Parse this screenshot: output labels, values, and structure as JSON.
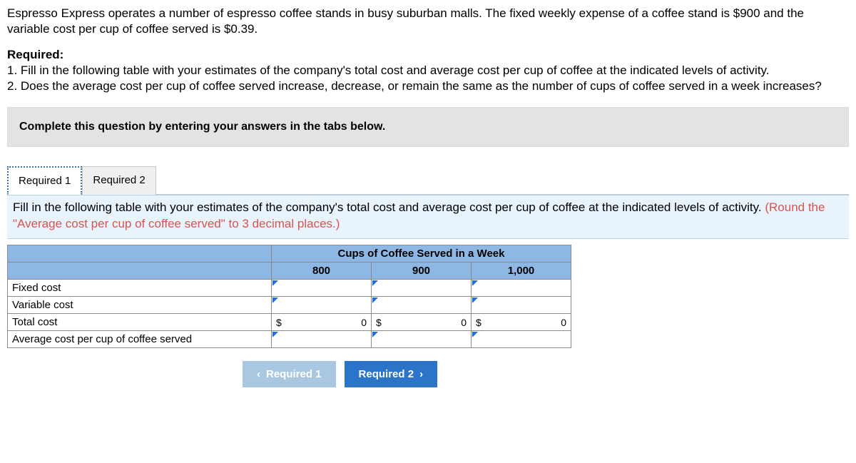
{
  "problem": {
    "p1": "Espresso Express operates a number of espresso coffee stands in busy suburban malls. The fixed weekly expense of a coffee stand is $900 and the variable cost per cup of coffee served is $0.39.",
    "required_label": "Required:",
    "q1": "1. Fill in the following table with your estimates of the company's total cost and average cost per cup of coffee at the indicated levels of activity.",
    "q2": "2. Does the average cost per cup of coffee served increase, decrease, or remain the same as the number of cups of coffee served in a week increases?"
  },
  "banner": "Complete this question by entering your answers in the tabs below.",
  "tabs": {
    "t1": "Required 1",
    "t2": "Required 2"
  },
  "instruction": {
    "main": "Fill in the following table with your estimates of the company's total cost and average cost per cup of coffee at the indicated levels of activity. ",
    "orange": "(Round the \"Average cost per cup of coffee served\" to 3 decimal places.)"
  },
  "table": {
    "header_span": "Cups of Coffee Served in a Week",
    "cols": [
      "800",
      "900",
      "1,000"
    ],
    "rows": {
      "fixed": "Fixed cost",
      "variable": "Variable cost",
      "total": "Total cost",
      "avg": "Average cost per cup of coffee served"
    },
    "currency": "$",
    "totals": [
      "0",
      "0",
      "0"
    ]
  },
  "nav": {
    "prev": "Required 1",
    "next": "Required 2"
  }
}
